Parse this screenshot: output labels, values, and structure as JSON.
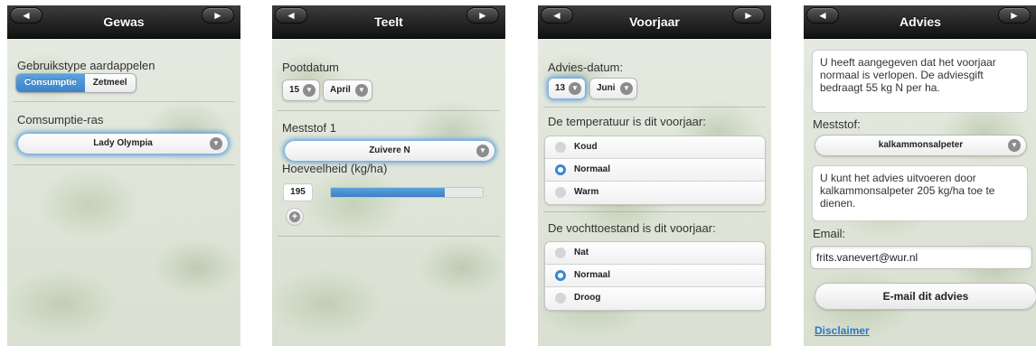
{
  "screens": [
    {
      "title": "Gewas",
      "nav_back": "◄",
      "nav_forward": "►",
      "usage_label": "Gebruikstype aardappelen",
      "usage_options": [
        "Consumptie",
        "Zetmeel"
      ],
      "usage_selected": "Consumptie",
      "variety_label": "Comsumptie-ras",
      "variety_value": "Lady Olympia"
    },
    {
      "title": "Teelt",
      "nav_back": "◄",
      "nav_forward": "►",
      "plant_date_label": "Pootdatum",
      "plant_day": "15",
      "plant_month": "April",
      "fertilizer_label": "Meststof 1",
      "fertilizer_value": "Zuivere N",
      "amount_label": "Hoeveelheid (kg/ha)",
      "amount_value": "195",
      "amount_fraction": 0.75
    },
    {
      "title": "Voorjaar",
      "nav_back": "◄",
      "nav_forward": "►",
      "advice_date_label": "Advies-datum:",
      "advice_day": "13",
      "advice_month": "Juni",
      "temp_label": "De temperatuur is dit voorjaar:",
      "temp_options": [
        "Koud",
        "Normaal",
        "Warm"
      ],
      "temp_selected": "Normaal",
      "moist_label": "De vochttoestand is dit voorjaar:",
      "moist_options": [
        "Nat",
        "Normaal",
        "Droog"
      ],
      "moist_selected": "Normaal"
    },
    {
      "title": "Advies",
      "nav_back": "◄",
      "nav_forward": "►",
      "summary_text": "U heeft aangegeven dat het voorjaar normaal is verlopen. De adviesgift bedraagt 55 kg N per ha.",
      "fertilizer_label": "Meststof:",
      "fertilizer_value": "kalkammonsalpeter",
      "advice_text": "U kunt het advies uitvoeren door kalkammonsalpeter 205 kg/ha toe te dienen.",
      "email_label": "Email:",
      "email_value": "frits.vanevert@wur.nl",
      "email_button": "E-mail dit advies",
      "disclaimer": "Disclaimer"
    }
  ],
  "colors": {
    "accent": "#3a86d3",
    "header": "#1e1e1e"
  },
  "icons": {
    "select": "chevron-down-icon",
    "add": "plus-icon",
    "back": "back-arrow-icon",
    "forward": "forward-arrow-icon"
  }
}
